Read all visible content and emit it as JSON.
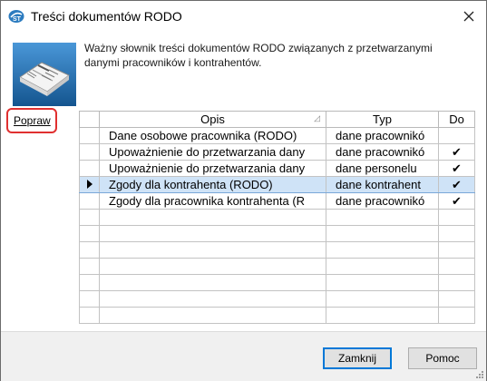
{
  "window": {
    "title": "Treści dokumentów RODO"
  },
  "description": "Ważny słownik treści dokumentów RODO związanych z przetwarzanymi danymi pracowników i kontrahentów.",
  "actions": {
    "popraw_label": "Popraw"
  },
  "grid": {
    "columns": {
      "opis": "Opis",
      "typ": "Typ",
      "do": "Do"
    },
    "rows": [
      {
        "opis": "Dane osobowe pracownika (RODO)",
        "typ": "dane pracownikó",
        "do": ""
      },
      {
        "opis": "Upoważnienie do przetwarzania dany",
        "typ": "dane pracownikó",
        "do": "✔"
      },
      {
        "opis": "Upoważnienie do przetwarzania dany",
        "typ": "dane personelu",
        "do": "✔"
      },
      {
        "opis": "Zgody dla kontrahenta (RODO)",
        "typ": "dane kontrahent",
        "do": "✔",
        "selected": true
      },
      {
        "opis": "Zgody dla pracownika kontrahenta (R",
        "typ": "dane pracownikó",
        "do": "✔"
      }
    ]
  },
  "buttons": {
    "close_label": "Zamknij",
    "help_label": "Pomoc"
  },
  "icons": {
    "app": "app-logo-icon",
    "close": "close-icon",
    "document": "rodo-document-icon",
    "row_pointer": "row-pointer-icon"
  },
  "colors": {
    "selection": "#cfe3f7",
    "highlight": "#e03030",
    "icon_bg": "#1f6fb5"
  }
}
